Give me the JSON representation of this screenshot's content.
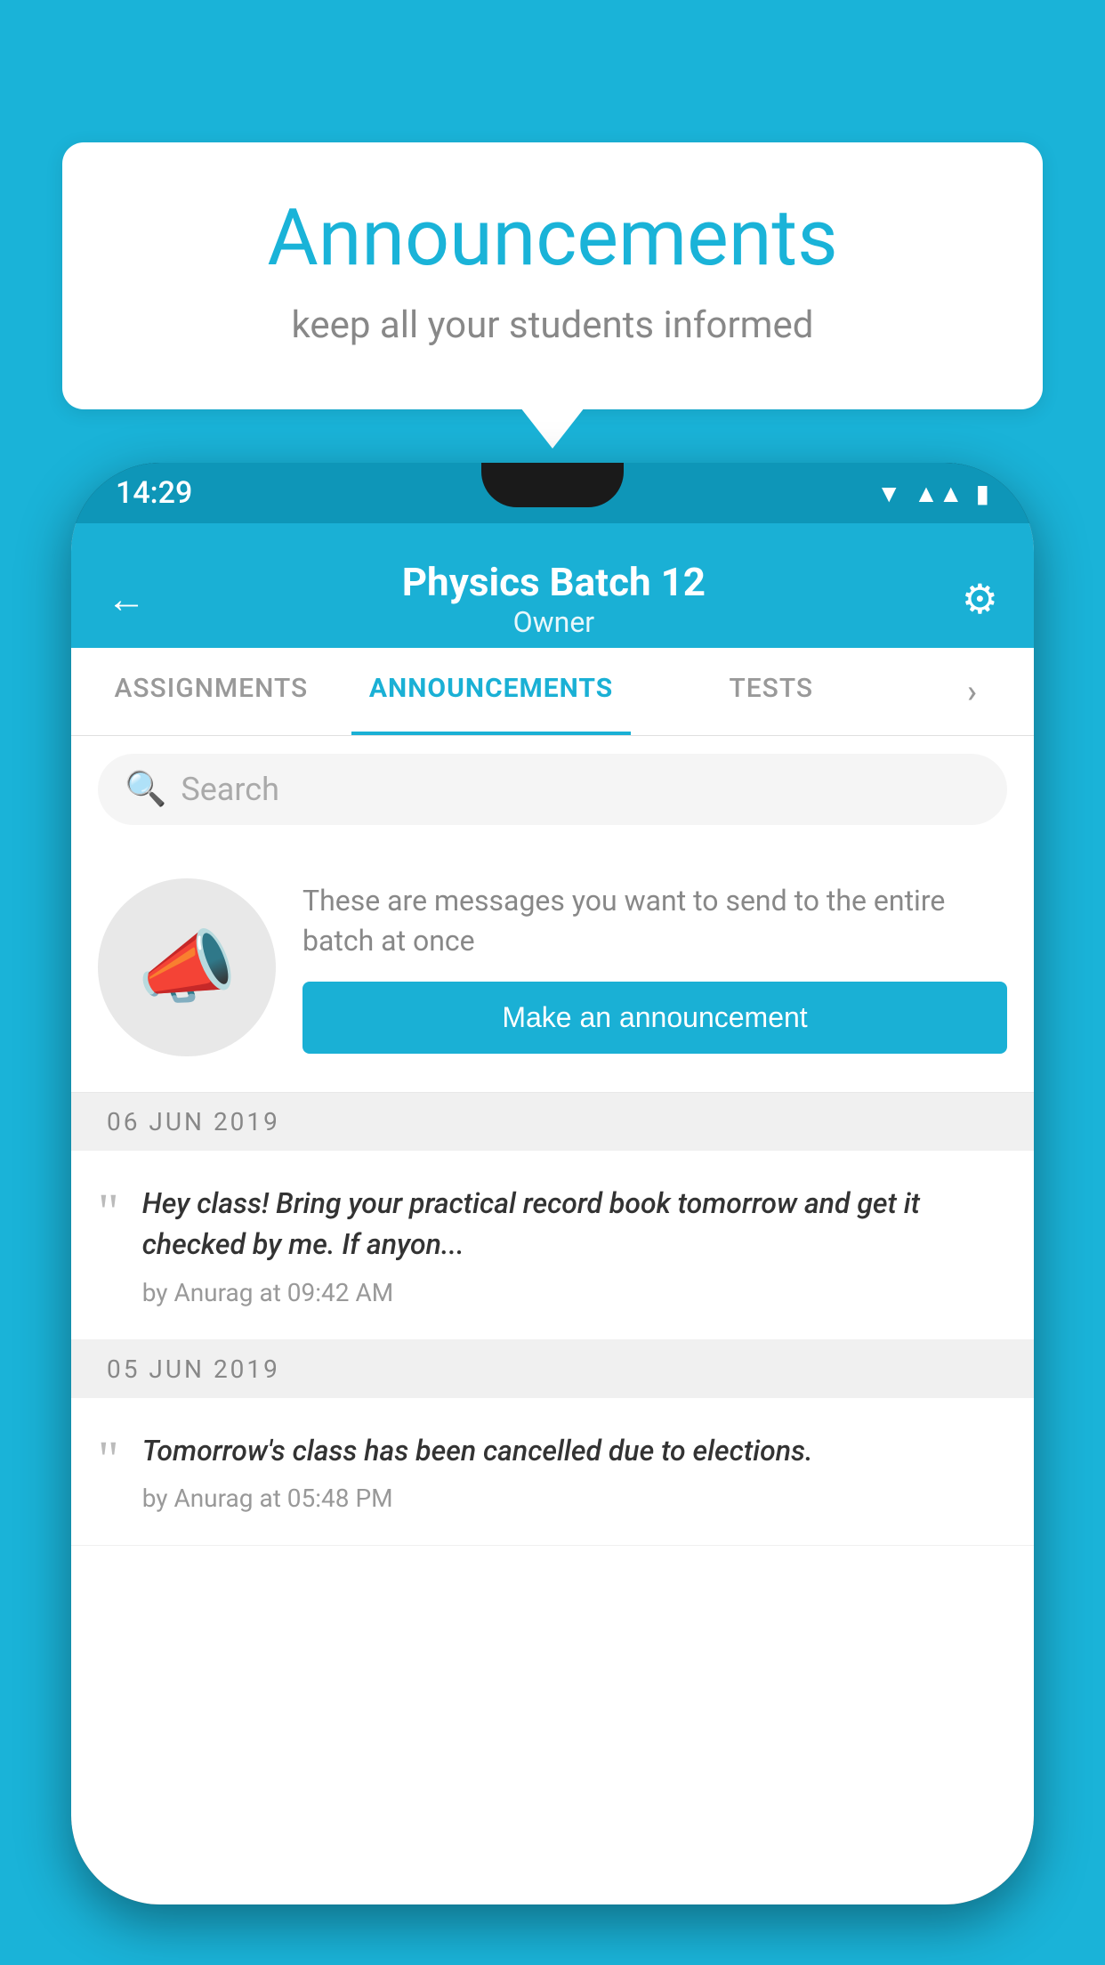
{
  "background_color": "#1ab3d8",
  "speech_bubble": {
    "title": "Announcements",
    "subtitle": "keep all your students informed"
  },
  "status_bar": {
    "time": "14:29"
  },
  "app_header": {
    "title": "Physics Batch 12",
    "subtitle": "Owner"
  },
  "tabs": [
    {
      "label": "ASSIGNMENTS",
      "active": false
    },
    {
      "label": "ANNOUNCEMENTS",
      "active": true
    },
    {
      "label": "TESTS",
      "active": false
    },
    {
      "label": "...",
      "active": false
    }
  ],
  "search": {
    "placeholder": "Search"
  },
  "promo": {
    "description": "These are messages you want to send to the entire batch at once",
    "button_label": "Make an announcement"
  },
  "announcements": [
    {
      "date": "06  JUN  2019",
      "text": "Hey class! Bring your practical record book tomorrow and get it checked by me. If anyon...",
      "meta": "by Anurag at 09:42 AM"
    },
    {
      "date": "05  JUN  2019",
      "text": "Tomorrow's class has been cancelled due to elections.",
      "meta": "by Anurag at 05:48 PM"
    }
  ],
  "icons": {
    "back_arrow": "←",
    "gear": "⚙",
    "search": "🔍",
    "quote": "““",
    "megaphone": "📣"
  }
}
